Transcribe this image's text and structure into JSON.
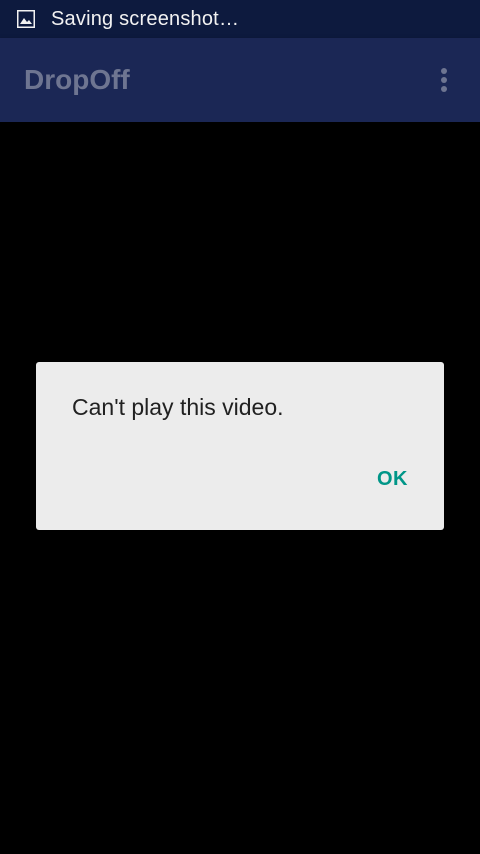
{
  "status_bar": {
    "icon": "image-icon",
    "text": "Saving screenshot…"
  },
  "app_bar": {
    "title": "DropOff",
    "overflow_icon": "more-vert-icon"
  },
  "dialog": {
    "message": "Can't play this video.",
    "ok_label": "OK"
  },
  "colors": {
    "status_bar": "#0d1a3e",
    "app_bar": "#1b2755",
    "app_title": "#6e7591",
    "dialog_bg": "#ececec",
    "accent": "#009688",
    "background": "#000000"
  }
}
